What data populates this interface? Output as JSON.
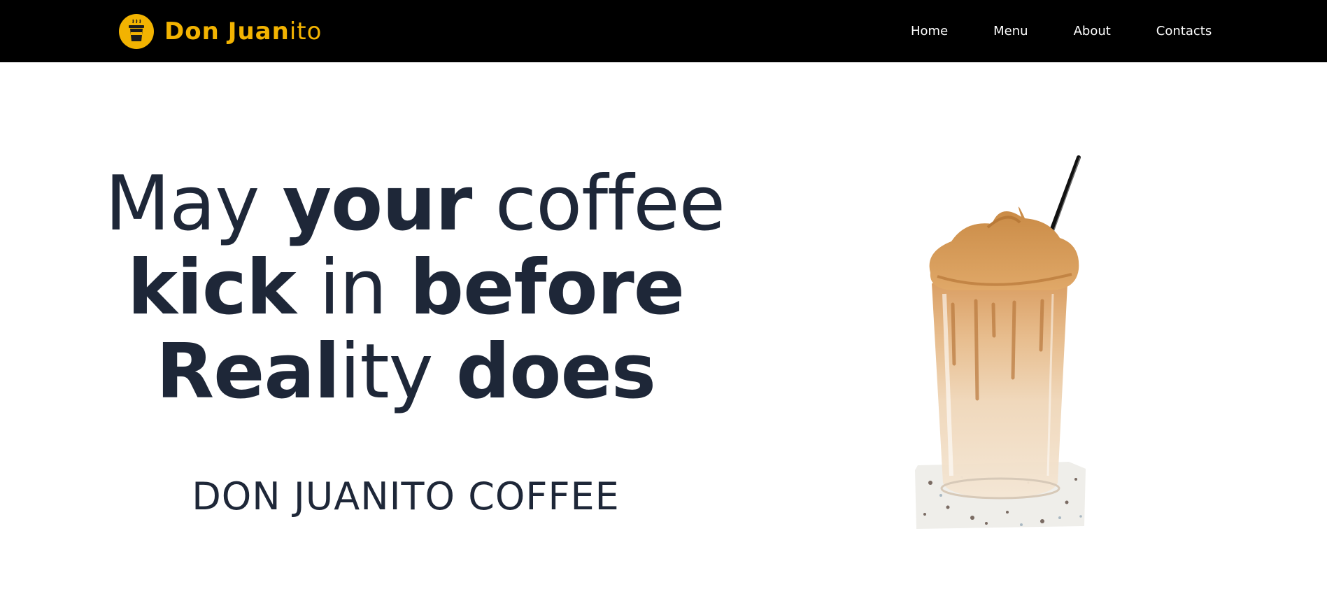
{
  "navbar": {
    "brand": {
      "part1": "Don",
      "part2": "Juan",
      "part3": "ito",
      "logo_icon": "coffee-cup-icon"
    },
    "links": [
      "Home",
      "Menu",
      "About",
      "Contacts"
    ]
  },
  "hero": {
    "headline": {
      "line1": {
        "a": "May ",
        "b": "your",
        "c": " coffee"
      },
      "line2": {
        "a": "kick",
        "b": " in ",
        "c": "before"
      },
      "line3": {
        "a": "Real",
        "b": "ity ",
        "c": "does"
      }
    },
    "subtitle": "DON JUANITO COFFEE",
    "image_icon": "iced-coffee-glass-image"
  },
  "colors": {
    "navbar_bg": "#000000",
    "brand": "#f2b301",
    "text_dark": "#1e2738",
    "nav_text": "#ffffff"
  }
}
